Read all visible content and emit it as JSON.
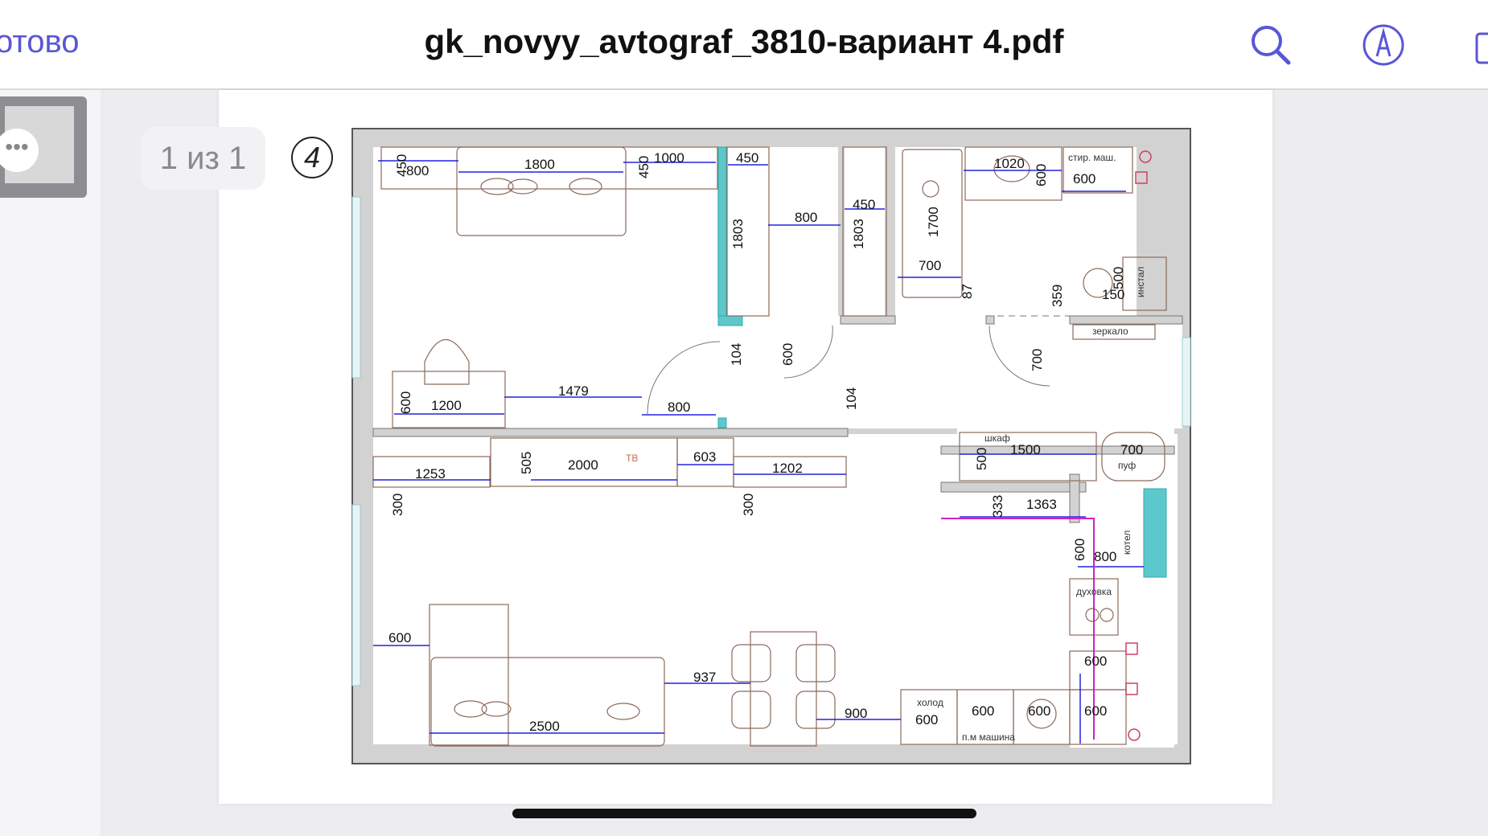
{
  "toolbar": {
    "done_label": "отово",
    "title": "gk_novyy_avtograf_3810-вариант 4.pdf",
    "icons": [
      "search-icon",
      "markup-icon",
      "share-icon"
    ]
  },
  "sidebar": {
    "more_label": "•••"
  },
  "viewer": {
    "page_indicator": "1 из 1",
    "plan_number": "4"
  },
  "plan": {
    "dims": {
      "d450a": "450",
      "d800top": "800",
      "d1800": "1800",
      "d450b": "450",
      "d1000": "1000",
      "d450c": "450",
      "d1803a": "1803",
      "d800hall": "800",
      "d450d": "450",
      "d1803b": "1803",
      "d1700": "1700",
      "d700bath": "700",
      "d87": "87",
      "d1020": "1020",
      "d600wc": "600",
      "d600wm": "600",
      "d359": "359",
      "d500": "500",
      "d150": "150",
      "d104a": "104",
      "d600door": "600",
      "d700door": "700",
      "d600desk": "600",
      "d1200": "1200",
      "d1479": "1479",
      "d800door": "800",
      "d104b": "104",
      "d1253": "1253",
      "d505": "505",
      "d2000": "2000",
      "d603": "603",
      "d1202": "1202",
      "d300a": "300",
      "d300b": "300",
      "d1500": "1500",
      "d500sh": "500",
      "d700puf": "700",
      "d333": "333",
      "d1363": "1363",
      "d600k": "600",
      "d800k": "800",
      "d600sofa": "600",
      "d2500": "2500",
      "d937": "937",
      "d900": "900",
      "d600fridge": "600",
      "d600wash": "600",
      "d600sink": "600",
      "d600hob": "600",
      "d600r": "600"
    },
    "labels": {
      "washer": "стир. маш.",
      "install": "инстал",
      "mirror": "зеркало",
      "tv": "ТВ",
      "wardrobe": "шкаф",
      "pouf": "пуф",
      "boiler": "котел",
      "oven": "духовка",
      "fridge": "холод",
      "dishwasher": "п.м машина"
    }
  }
}
